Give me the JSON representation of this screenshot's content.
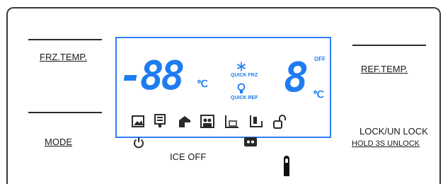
{
  "labels": {
    "frz_temp": "FRZ.TEMP.",
    "ref_temp": "REF.TEMP.",
    "mode": "MODE",
    "lock_unlock": "LOCK/UN LOCK",
    "hold_unlock": "HOLD 3S UNLOCK",
    "ice_off": "ICE OFF"
  },
  "display": {
    "freezer_digits": "-88",
    "fridge_digit": "8",
    "unit_symbol": "℃",
    "quick_frz": "QUICK FRZ",
    "quick_ref": "QUICK REF",
    "off_label": "OFF"
  },
  "colors": {
    "lcd_blue": "#1e7cf0",
    "icon_dark": "#2a2a2a"
  },
  "icons": [
    "picture-icon",
    "menu-icon",
    "ice-off-icon",
    "party-icon",
    "fuzzy-icon",
    "holiday-icon",
    "lock-icon",
    "power-icon",
    "child-lock-icon",
    "finger-icon"
  ]
}
